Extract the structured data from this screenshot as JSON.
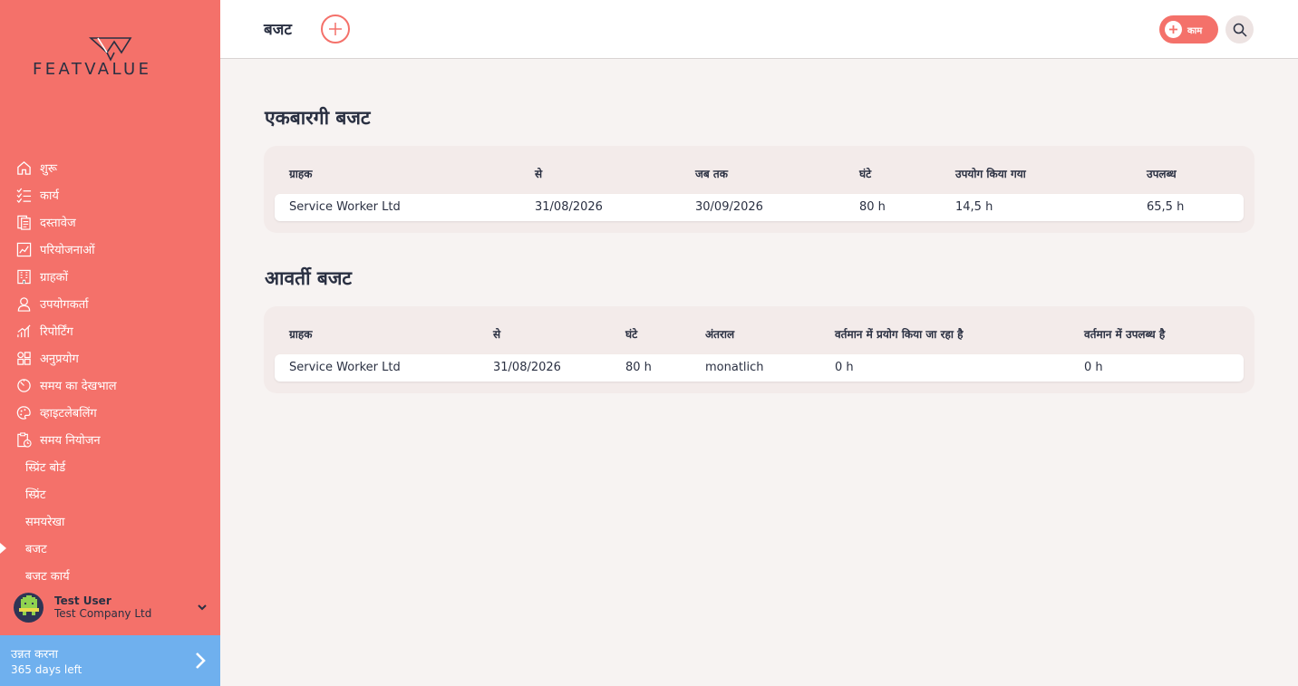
{
  "sidebar": {
    "logo": "FEATVALUE",
    "nav": [
      {
        "label": "शुरू",
        "icon": "home-icon"
      },
      {
        "label": "कार्य",
        "icon": "task-list-icon"
      },
      {
        "label": "दस्तावेज",
        "icon": "document-icon"
      },
      {
        "label": "परियोजनाओं",
        "icon": "project-chart-icon"
      },
      {
        "label": "ग्राहकों",
        "icon": "building-icon"
      },
      {
        "label": "उपयोगकर्ता",
        "icon": "user-icon"
      },
      {
        "label": "रिपोर्टिंग",
        "icon": "reporting-icon"
      },
      {
        "label": "अनुप्रयोग",
        "icon": "apps-icon"
      },
      {
        "label": "समय का देखभाल",
        "icon": "timer-icon"
      },
      {
        "label": "व्हाइटलेबलिंग",
        "icon": "palette-icon"
      },
      {
        "label": "समय नियोजन",
        "icon": "clipboard-clock-icon"
      }
    ],
    "subnav": [
      {
        "label": "स्प्रिंट बोर्ड",
        "active": false
      },
      {
        "label": "स्प्रिंट",
        "active": false
      },
      {
        "label": "समयरेखा",
        "active": false
      },
      {
        "label": "बजट",
        "active": true
      },
      {
        "label": "बजट कार्य",
        "active": false
      }
    ],
    "user": {
      "name": "Test User",
      "company": "Test Company Ltd"
    },
    "upgrade": {
      "title": "उन्नत करना",
      "subtitle": "365 days left"
    }
  },
  "header": {
    "title": "बजट",
    "task_button": "काम"
  },
  "one_time": {
    "title": "एकबारगी बजट",
    "columns": [
      "ग्राहक",
      "से",
      "जब तक",
      "घंटे",
      "उपयोग किया गया",
      "उपलब्ध"
    ],
    "rows": [
      [
        "Service Worker Ltd",
        "31/08/2026",
        "30/09/2026",
        "80 h",
        "14,5 h",
        "65,5 h"
      ]
    ]
  },
  "recurring": {
    "title": "आवर्ती बजट",
    "columns": [
      "ग्राहक",
      "से",
      "घंटे",
      "अंतराल",
      "वर्तमान में प्रयोग किया जा रहा है",
      "वर्तमान में उपलब्ध है"
    ],
    "rows": [
      [
        "Service Worker Ltd",
        "31/08/2026",
        "80 h",
        "monatlich",
        "0 h",
        "0 h"
      ]
    ]
  },
  "colors": {
    "sidebar": "#f4716a",
    "upgrade": "#6fb0ee",
    "text": "#2a3042",
    "panel": "#f3ebea"
  }
}
